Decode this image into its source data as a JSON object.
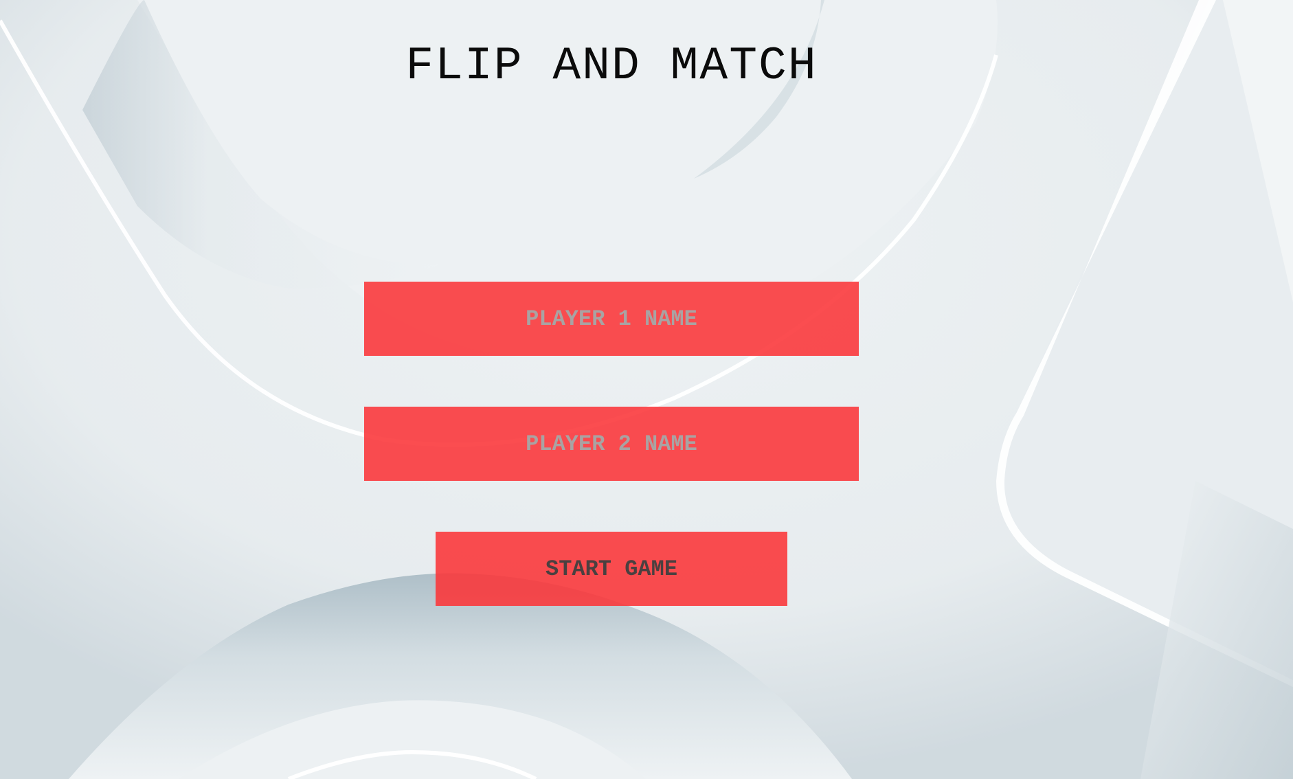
{
  "game": {
    "title": "FLIP AND MATCH"
  },
  "form": {
    "player1_placeholder": "PLAYER 1 NAME",
    "player1_value": "",
    "player2_placeholder": "PLAYER 2 NAME",
    "player2_value": "",
    "start_label": "START GAME"
  },
  "colors": {
    "background": "#edf1f3",
    "accent": "#fa3438",
    "title_text": "#0b0b0b"
  }
}
